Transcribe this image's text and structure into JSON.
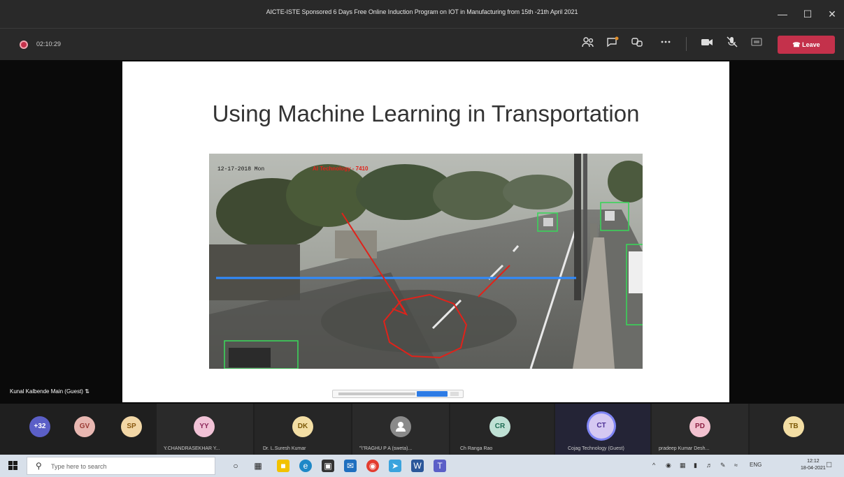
{
  "window": {
    "title": "AICTE-ISTE Sponsored 6 Days Free Online Induction Program on IOT in Manufacturing from 15th -21th April 2021",
    "minimize": "—",
    "maximize": "☐",
    "close": "✕"
  },
  "toolbar": {
    "timer": "02:10:29",
    "leave_label": "Leave",
    "icons": [
      "participants-icon",
      "chat-icon",
      "reactions-icon",
      "more-icon",
      "camera-icon",
      "mic-off-icon",
      "share-icon"
    ]
  },
  "slide": {
    "title": "Using Machine Learning in Transportation",
    "video_timestamp": "12-17-2018  Mon",
    "video_overlay": "AI Technology - 7410"
  },
  "presenter": {
    "name": "Kunal Kalbende Main (Guest)"
  },
  "participants": {
    "overflow": "+32",
    "items": [
      {
        "initials": "GV",
        "name": "",
        "color": "#e8b7b1",
        "text_color": "#9a3b34"
      },
      {
        "initials": "SP",
        "name": "",
        "color": "#f2d7a6",
        "text_color": "#8a5a12"
      },
      {
        "initials": "YY",
        "name": "Y.CHANDRASEKHAR Y...",
        "color": "#f1c2d6",
        "text_color": "#8b2759"
      },
      {
        "initials": "DK",
        "name": "Dr. L.Suresh Kumar",
        "color": "#f3dea4",
        "text_color": "#7d5a08"
      },
      {
        "initials": "",
        "name": "\"\\\"RAGHU P A (sweta)...",
        "color": "#8a8a8a",
        "text_color": "#fff"
      },
      {
        "initials": "CR",
        "name": "Ch Ranga Rao",
        "color": "#bfe0d4",
        "text_color": "#1d6b52"
      },
      {
        "initials": "CT",
        "name": "Cojag Technology (Guest)",
        "color": "#d5c8f2",
        "text_color": "#4b2f94"
      },
      {
        "initials": "PD",
        "name": "pradeep Kumar Desh...",
        "color": "#f2c2d0",
        "text_color": "#8c1f42"
      },
      {
        "initials": "TB",
        "name": "",
        "color": "#f3dea4",
        "text_color": "#7d5a08"
      }
    ]
  },
  "taskbar": {
    "search_placeholder": "Type here to search",
    "lang": "ENG",
    "time": "12:12",
    "date": "18-04-2021"
  }
}
